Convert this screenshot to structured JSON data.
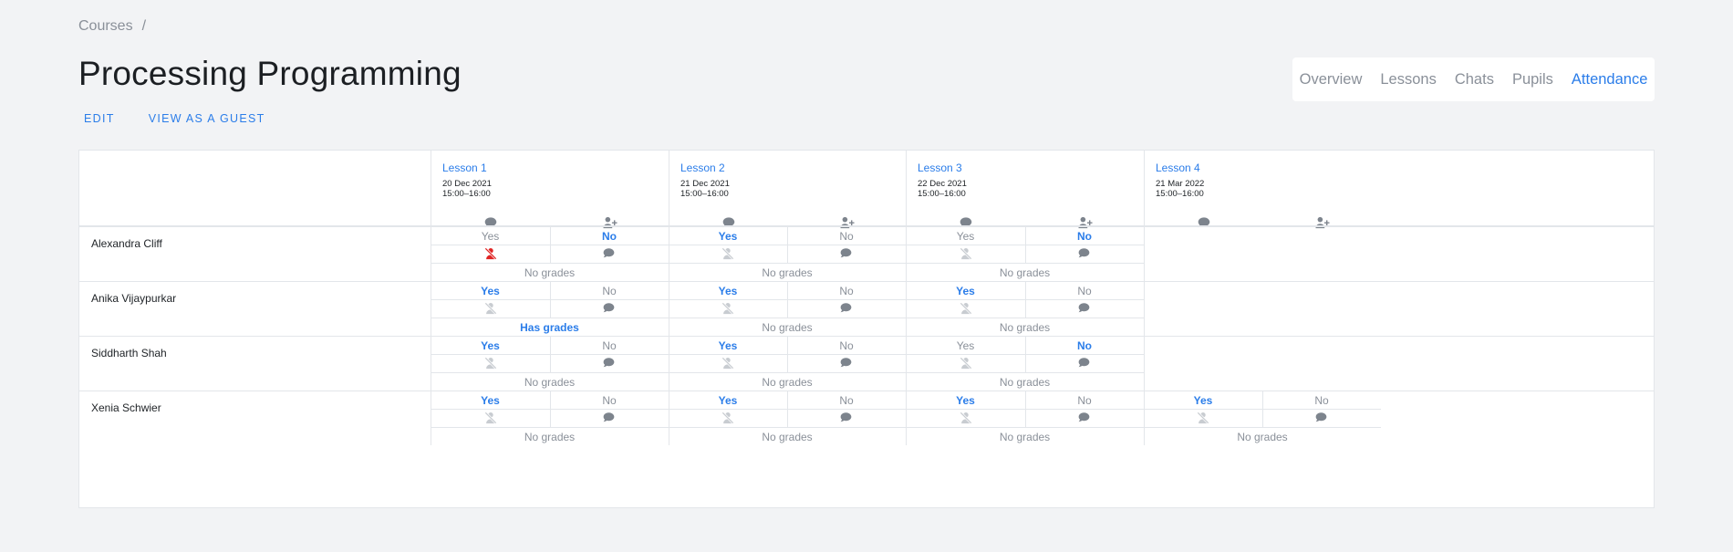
{
  "breadcrumb": {
    "courses": "Courses",
    "separator": "/"
  },
  "page": {
    "title": "Processing Programming"
  },
  "actions": {
    "edit": "EDIT",
    "view_as_guest": "VIEW AS A GUEST"
  },
  "tabs": [
    "Overview",
    "Lessons",
    "Chats",
    "Pupils",
    "Attendance"
  ],
  "active_tab": "Attendance",
  "lessons": [
    {
      "name": "Lesson 1",
      "date": "20 Dec 2021",
      "time": "15:00–16:00"
    },
    {
      "name": "Lesson 2",
      "date": "21 Dec 2021",
      "time": "15:00–16:00"
    },
    {
      "name": "Lesson 3",
      "date": "22 Dec 2021",
      "time": "15:00–16:00"
    },
    {
      "name": "Lesson 4",
      "date": "21 Mar 2022",
      "time": "15:00–16:00"
    }
  ],
  "header_icons": {
    "chat": "comment-icon",
    "attendance": "user-plus-icon"
  },
  "students": [
    {
      "name": "Alexandra Cliff",
      "records": [
        {
          "yes": "Yes",
          "no": "No",
          "answer": "no",
          "absent": true,
          "grades": "No grades"
        },
        {
          "yes": "Yes",
          "no": "No",
          "answer": "yes",
          "absent": false,
          "grades": "No grades"
        },
        {
          "yes": "Yes",
          "no": "No",
          "answer": "no",
          "absent": false,
          "grades": "No grades"
        },
        null
      ]
    },
    {
      "name": "Anika Vijaypurkar",
      "records": [
        {
          "yes": "Yes",
          "no": "No",
          "answer": "yes",
          "absent": false,
          "grades": "Has grades"
        },
        {
          "yes": "Yes",
          "no": "No",
          "answer": "yes",
          "absent": false,
          "grades": "No grades"
        },
        {
          "yes": "Yes",
          "no": "No",
          "answer": "yes",
          "absent": false,
          "grades": "No grades"
        },
        null
      ]
    },
    {
      "name": "Siddharth Shah",
      "records": [
        {
          "yes": "Yes",
          "no": "No",
          "answer": "yes",
          "absent": false,
          "grades": "No grades"
        },
        {
          "yes": "Yes",
          "no": "No",
          "answer": "yes",
          "absent": false,
          "grades": "No grades"
        },
        {
          "yes": "Yes",
          "no": "No",
          "answer": "no",
          "absent": false,
          "grades": "No grades"
        },
        null
      ]
    },
    {
      "name": "Xenia Schwier",
      "records": [
        {
          "yes": "Yes",
          "no": "No",
          "answer": "yes",
          "absent": false,
          "grades": "No grades"
        },
        {
          "yes": "Yes",
          "no": "No",
          "answer": "yes",
          "absent": false,
          "grades": "No grades"
        },
        {
          "yes": "Yes",
          "no": "No",
          "answer": "yes",
          "absent": false,
          "grades": "No grades"
        },
        {
          "yes": "Yes",
          "no": "No",
          "answer": "yes",
          "absent": false,
          "grades": "No grades"
        }
      ]
    }
  ],
  "colors": {
    "accent": "#2b7de9",
    "muted": "#8a9099",
    "absent_red": "#e02424",
    "background": "#f2f3f5"
  }
}
